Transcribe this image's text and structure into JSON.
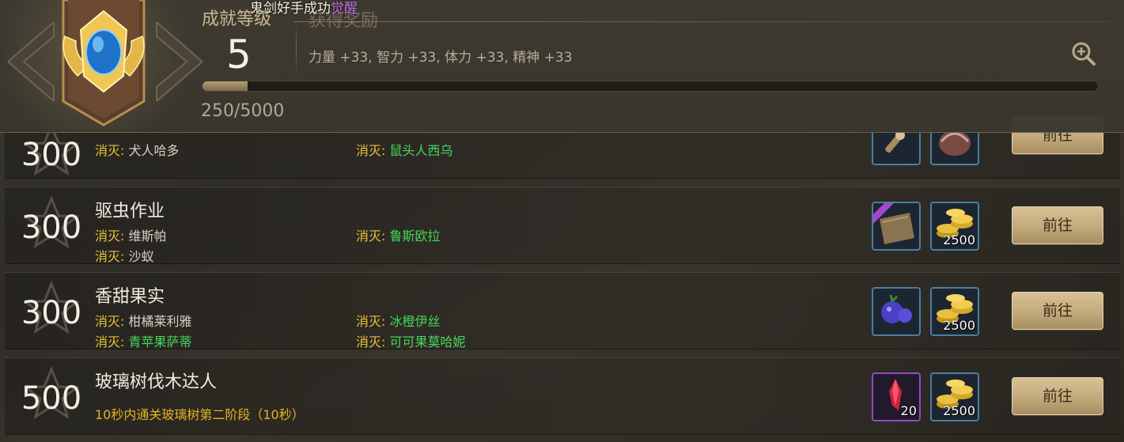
{
  "header": {
    "level_label": "成就等级",
    "level_value": "5",
    "rewards_label": "获得奖励",
    "toast_text": "鬼剑好手成功",
    "toast_accent": "觉醒",
    "rewards_text": "力量 +33, 智力 +33, 体力 +33, 精神 +33",
    "progress_text": "250/5000",
    "progress_fraction": 0.05
  },
  "achievements": [
    {
      "points": "300",
      "title": "",
      "reqs": [
        {
          "prefix": "消灭:",
          "target": "犬人哈多",
          "done": false
        },
        {
          "prefix": "消灭:",
          "target": "鼠头人西乌",
          "done": true
        }
      ],
      "button": "前往"
    },
    {
      "points": "300",
      "title": "驱虫作业",
      "reqs": [
        {
          "prefix": "消灭:",
          "target": "维斯帕",
          "done": false
        },
        {
          "prefix": "消灭:",
          "target": "鲁斯欧拉",
          "done": true
        },
        {
          "prefix": "消灭:",
          "target": "沙蚁",
          "done": false
        }
      ],
      "reward_qty": "2500",
      "button": "前往"
    },
    {
      "points": "300",
      "title": "香甜果实",
      "reqs": [
        {
          "prefix": "消灭:",
          "target": "柑橘莱利雅",
          "done": false
        },
        {
          "prefix": "消灭:",
          "target": "冰橙伊丝",
          "done": true
        },
        {
          "prefix": "消灭:",
          "target": "青苹果萨蒂",
          "done": true
        },
        {
          "prefix": "消灭:",
          "target": "可可果莫哈妮",
          "done": true
        }
      ],
      "reward_qty": "2500",
      "button": "前往"
    },
    {
      "points": "500",
      "title": "玻璃树伐木达人",
      "desc": "10秒内通关玻璃树第二阶段（10秒）",
      "reward_item_qty": "20",
      "reward_qty": "2500",
      "button": "前往"
    }
  ],
  "colors": {
    "req_prefix": "#e6c23a",
    "req_done": "#46d75a",
    "req_pending": "#d6d0c2",
    "desc": "#e6b325",
    "button": "#c2aa7b"
  }
}
